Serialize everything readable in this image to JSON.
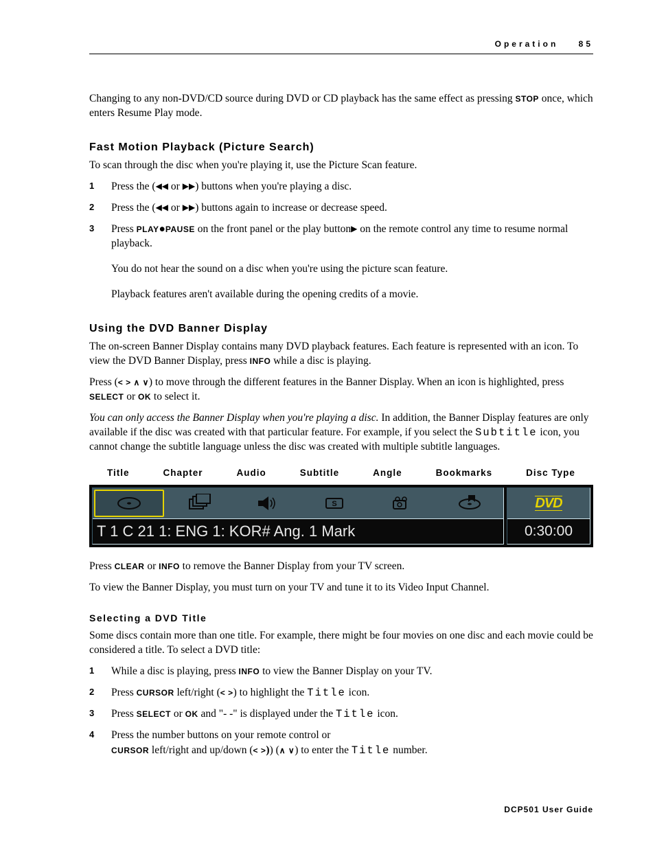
{
  "header": {
    "section": "Operation",
    "page": "85"
  },
  "intro": {
    "para": "Changing to any non-DVD/CD source during DVD or CD playback has the same effect as pressing ",
    "key": "STOP",
    "tail": " once, which enters Resume Play mode."
  },
  "fast": {
    "heading": "Fast Motion Playback (Picture Search)",
    "lead": "To scan through the disc when you're playing it, use the Picture Scan feature.",
    "steps": {
      "s1": {
        "a": "Press the (",
        "b": " or ",
        "c": ") buttons when you're playing a disc."
      },
      "s2": {
        "a": "Press the (",
        "b": " or ",
        "c": ") buttons again to increase or decrease speed."
      },
      "s3": {
        "a": "Press ",
        "key1": "PLAY",
        "bullet": "●",
        "key2": "PAUSE",
        "b": " on the front panel or the play button",
        "c": " on the remote control any time to resume normal playback.",
        "note1": "You do not hear the sound on a disc when you're using the picture scan feature.",
        "note2": "Playback features aren't available during the opening credits of a movie."
      }
    }
  },
  "banner": {
    "heading": "Using the DVD Banner Display",
    "p1a": "The on-screen Banner Display contains many DVD playback features. Each feature is represented with an icon. To view the DVD Banner Display, press ",
    "key_info": "INFO",
    "p1b": " while a disc is playing.",
    "p2a": "Press (",
    "syms": "< > ∧ ∨",
    "p2b": ") to move through the different features in the Banner Display. When an icon is highlighted, press ",
    "key_select": "SELECT",
    "or": " or ",
    "key_ok": "OK",
    "p2c": " to select it.",
    "p3_italic": "You can only access the Banner Display when you're playing a disc.",
    "p3_rest": " In addition, the Banner Display features are only available if the disc was created with that particular feature. For example, if you select the ",
    "p3_ui": "Subtitle",
    "p3_end": " icon, you cannot change the subtitle language unless the disc was created with multiple subtitle languages.",
    "labels": [
      "Title",
      "Chapter",
      "Audio",
      "Subtitle",
      "Angle",
      "Bookmarks",
      "Disc Type"
    ],
    "textrow": "T  1    C  21  1: ENG 1: KOR# Ang. 1   Mark",
    "dvd": "DVD",
    "time": "0:30:00",
    "after1a": "Press ",
    "key_clear": "CLEAR",
    "after1b": " or ",
    "after1c": " to remove the Banner Display from your TV screen.",
    "after2": "To view the Banner Display, you must turn on your TV and tune it to its Video Input Channel."
  },
  "selecting": {
    "heading": "Selecting a DVD Title",
    "lead": "Some discs contain more than one title. For example, there might be four movies on one disc and each movie could be considered a title. To select a DVD title:",
    "s1a": "While a disc is playing, press ",
    "s1b": " to view the Banner Display on your TV.",
    "s2a": "Press ",
    "key_cursor": "CURSOR",
    "s2b": " left/right (",
    "s2syms": "< >",
    "s2c": ") to highlight the ",
    "s2ui": "Title",
    "s2d": " icon.",
    "s3a": "Press ",
    "s3b": " or ",
    "s3c": " and \"- -\" is displayed under the ",
    "s3ui": "Title",
    "s3d": " icon.",
    "s4a": "Press the number buttons on your remote control or",
    "s4b": " left/right and up/down (",
    "s4s1": "< >",
    "s4c": ") (",
    "s4s2": "∧ ∨",
    "s4d": ") to enter the ",
    "s4ui": "Title",
    "s4e": " number."
  },
  "footer": "DCP501 User Guide"
}
